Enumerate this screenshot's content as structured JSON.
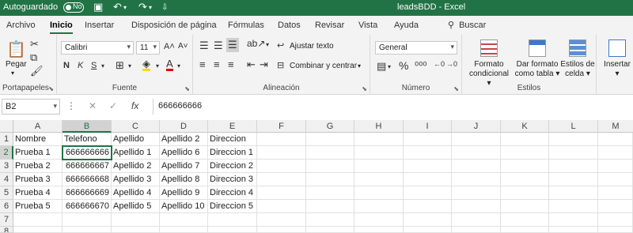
{
  "titlebar": {
    "autosave_label": "Autoguardado",
    "autosave_state": "No",
    "document_title": "leadsBDD  -  Excel"
  },
  "tabs": [
    "Archivo",
    "Inicio",
    "Insertar",
    "Disposición de página",
    "Fórmulas",
    "Datos",
    "Revisar",
    "Vista",
    "Ayuda"
  ],
  "search_label": "Buscar",
  "ribbon": {
    "clipboard": {
      "paste": "Pegar",
      "label": "Portapapeles"
    },
    "font": {
      "family": "Calibri",
      "size": "11",
      "bold": "N",
      "italic": "K",
      "underline": "S",
      "label": "Fuente"
    },
    "alignment": {
      "wrap": "Ajustar texto",
      "merge": "Combinar y centrar",
      "label": "Alineación"
    },
    "number": {
      "format": "General",
      "label": "Número"
    },
    "styles": {
      "conditional": [
        "Formato",
        "condicional"
      ],
      "table": [
        "Dar formato",
        "como tabla"
      ],
      "cell": [
        "Estilos de",
        "celda"
      ],
      "label": "Estilos"
    },
    "insert": "Insertar"
  },
  "formula_bar": {
    "cell_ref": "B2",
    "content": "666666666"
  },
  "sheet": {
    "columns": [
      "A",
      "B",
      "C",
      "D",
      "E",
      "F",
      "G",
      "H",
      "I",
      "J",
      "K",
      "L",
      "M"
    ],
    "rows": [
      "1",
      "2",
      "3",
      "4",
      "5",
      "6",
      "7",
      "8"
    ],
    "header": [
      "Nombre",
      "Telefono",
      "Apellido",
      "Apellido 2",
      "Direccion"
    ],
    "data": [
      [
        "Prueba 1",
        "666666666",
        "Apellido 1",
        "Apellido 6",
        "Direccion 1"
      ],
      [
        "Prueba 2",
        "666666667",
        "Apellido 2",
        "Apellido 7",
        "Direccion 2"
      ],
      [
        "Prueba 3",
        "666666668",
        "Apellido 3",
        "Apellido 8",
        "Direccion 3"
      ],
      [
        "Prueba 4",
        "666666669",
        "Apellido 4",
        "Apellido 9",
        "Direccion 4"
      ],
      [
        "Prueba 5",
        "666666670",
        "Apellido 5",
        "Apellido 10",
        "Direccion 5"
      ]
    ]
  },
  "colors": {
    "brand": "#217346"
  }
}
